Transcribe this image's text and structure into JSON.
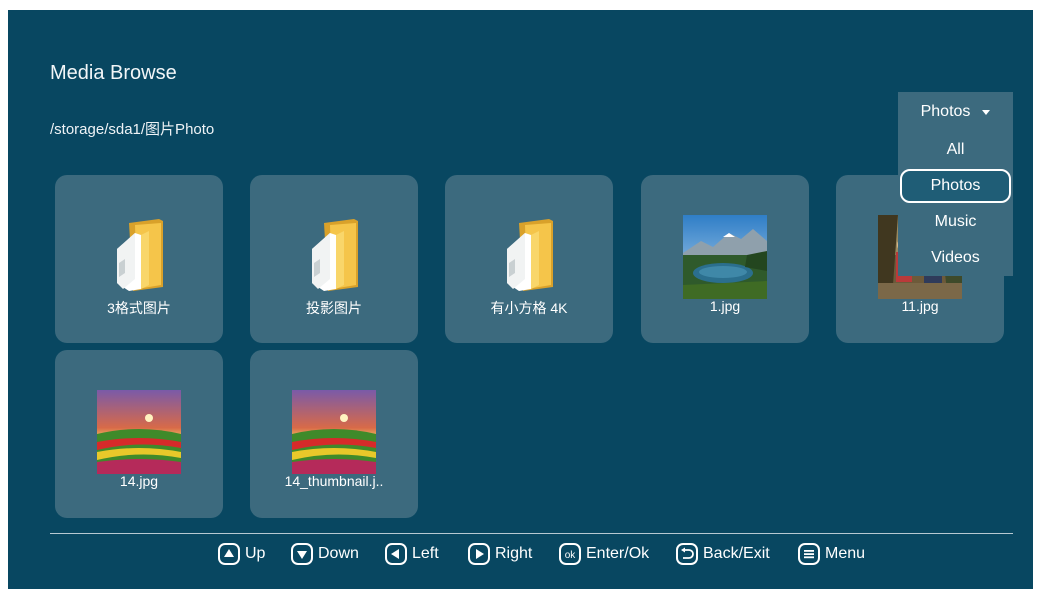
{
  "header": {
    "title": "Media Browse",
    "path": "/storage/sda1/图片Photo"
  },
  "filter": {
    "selected": "Photos",
    "options": [
      "All",
      "Photos",
      "Music",
      "Videos"
    ]
  },
  "items": [
    {
      "name": "3格式图片",
      "kind": "folder"
    },
    {
      "name": "投影图片",
      "kind": "folder"
    },
    {
      "name": "有小方格 4K",
      "kind": "folder"
    },
    {
      "name": "1.jpg",
      "kind": "image"
    },
    {
      "name": "11.jpg",
      "kind": "image"
    },
    {
      "name": "14.jpg",
      "kind": "image"
    },
    {
      "name": "14_thumbnail.j..",
      "kind": "image"
    }
  ],
  "footer": {
    "hints": [
      {
        "icon": "up-icon",
        "label": "Up"
      },
      {
        "icon": "down-icon",
        "label": "Down"
      },
      {
        "icon": "left-icon",
        "label": "Left"
      },
      {
        "icon": "right-icon",
        "label": "Right"
      },
      {
        "icon": "ok-icon",
        "label": "Enter/Ok"
      },
      {
        "icon": "back-icon",
        "label": "Back/Exit"
      },
      {
        "icon": "menu-icon",
        "label": "Menu"
      }
    ]
  },
  "colors": {
    "background": "#084761",
    "tile": "#3c6a7e",
    "folder": "#f5c54a",
    "text": "#ffffff"
  }
}
